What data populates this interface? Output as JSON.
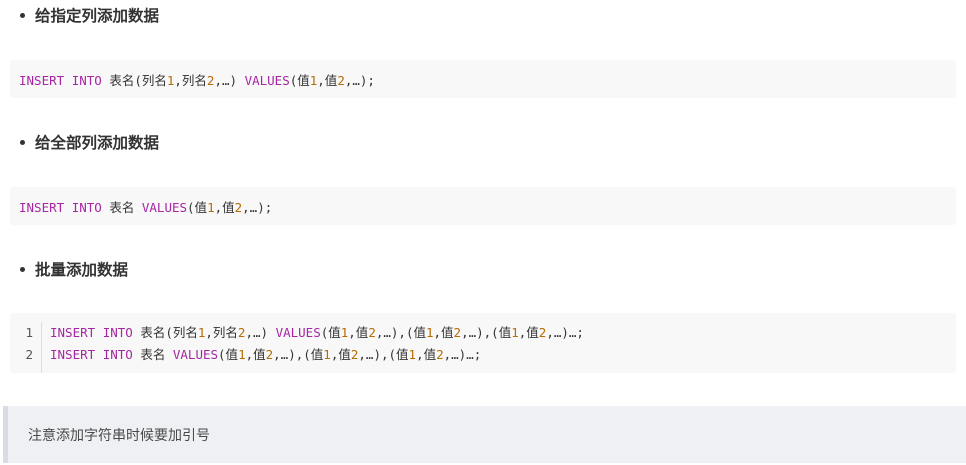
{
  "sections": [
    {
      "heading": "给指定列添加数据",
      "code": {
        "kw1": "INSERT",
        "kw2": "INTO",
        "t1": "表名(列名",
        "n1": "1",
        "t2": ",列名",
        "n2": "2",
        "t3": ",…)",
        "kw3": "VALUES",
        "t4": "(值",
        "n3": "1",
        "t5": ",值",
        "n4": "2",
        "t6": ",…);"
      }
    },
    {
      "heading": "给全部列添加数据",
      "code": {
        "kw1": "INSERT",
        "kw2": "INTO",
        "t1": "表名",
        "kw3": "VALUES",
        "t2": "(值",
        "n1": "1",
        "t3": ",值",
        "n2": "2",
        "t4": ",…);"
      }
    },
    {
      "heading": "批量添加数据",
      "line_numbers": [
        "1",
        "2"
      ],
      "line1": {
        "kw1": "INSERT",
        "kw2": "INTO",
        "t1": "表名(列名",
        "n1": "1",
        "t2": ",列名",
        "n2": "2",
        "t3": ",…)",
        "kw3": "VALUES",
        "t4": "(值",
        "n3": "1",
        "t5": ",值",
        "n4": "2",
        "t6": ",…),(值",
        "n5": "1",
        "t7": ",值",
        "n6": "2",
        "t8": ",…),(值",
        "n7": "1",
        "t9": ",值",
        "n8": "2",
        "t10": ",…)…;"
      },
      "line2": {
        "kw1": "INSERT",
        "kw2": "INTO",
        "t1": "表名",
        "kw3": "VALUES",
        "t2": "(值",
        "n1": "1",
        "t3": ",值",
        "n2": "2",
        "t4": ",…),(值",
        "n3": "1",
        "t5": ",值",
        "n4": "2",
        "t6": ",…),(值",
        "n5": "1",
        "t7": ",值",
        "n6": "2",
        "t8": ",…)…;"
      }
    }
  ],
  "note": "注意添加字符串时候要加引号",
  "colors": {
    "keyword": "#a626a4",
    "number": "#b76b01",
    "code_bg": "#f8f8f8",
    "note_bg": "#eef0f4"
  }
}
